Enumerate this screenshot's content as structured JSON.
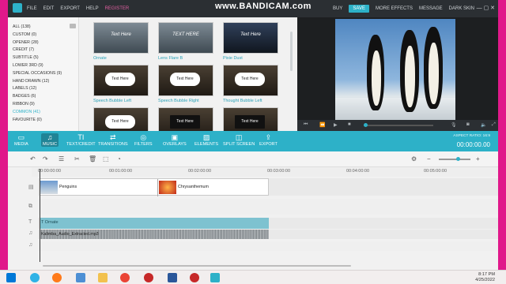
{
  "menubar": {
    "items": [
      "FILE",
      "EDIT",
      "EXPORT",
      "HELP",
      "REGISTER"
    ],
    "watermark": "www.BANDICAM.com",
    "right_items": [
      "BUY",
      "SAVE",
      "MORE EFFECTS",
      "MESSAGE",
      "DARK SKIN"
    ]
  },
  "sidebar": {
    "items": [
      "ALL (138)",
      "CUSTOM (0)",
      "OPENER (28)",
      "CREDIT (7)",
      "SUBTITLE (5)",
      "LOWER 3RD (9)",
      "SPECIAL OCCASIONS (9)",
      "HAND DRAWN (12)",
      "LABELS (12)",
      "BADGES (6)",
      "RIBBON (9)",
      "COMMON (41)",
      "FAVOURITE (0)"
    ],
    "active_index": 11
  },
  "thumbnails": [
    {
      "caption": "Ornate",
      "overlay": "Text Here"
    },
    {
      "caption": "Lens Flare B",
      "overlay": "TEXT HERE"
    },
    {
      "caption": "Pixie Dust",
      "overlay": "Text Here"
    },
    {
      "caption": "Speech Bubble Left",
      "overlay": "Text Here"
    },
    {
      "caption": "Speech Bubble Right",
      "overlay": "Text Here"
    },
    {
      "caption": "Thought Bubble Left",
      "overlay": "Text Here"
    },
    {
      "caption": "",
      "overlay": "Text Here"
    },
    {
      "caption": "",
      "overlay": "Text Here"
    },
    {
      "caption": "",
      "overlay": "Text Here"
    }
  ],
  "toolbar": {
    "tools": [
      "MEDIA",
      "MUSIC",
      "TEXT/CREDIT",
      "TRANSITIONS",
      "FILTERS",
      "OVERLAYS",
      "ELEMENTS",
      "SPLIT SCREEN",
      "EXPORT"
    ],
    "active_index": 1,
    "aspect_ratio": "ASPECT RATIO: 16:9",
    "timecode": "00:00:00.00"
  },
  "ruler": [
    "00:00:00:00",
    "00:01:00:00",
    "00:02:00:00",
    "00:03:00:00",
    "00:04:00:00",
    "00:05:00:00"
  ],
  "timeline": {
    "video_clips": [
      "Penguins",
      "Chrysanthemum"
    ],
    "text_clip": "T Ornate",
    "audio_clip": "Kalimba_Audio_Extracted.mp3"
  },
  "taskbar": {
    "time": "8:17 PM",
    "date": "4/25/2022"
  }
}
